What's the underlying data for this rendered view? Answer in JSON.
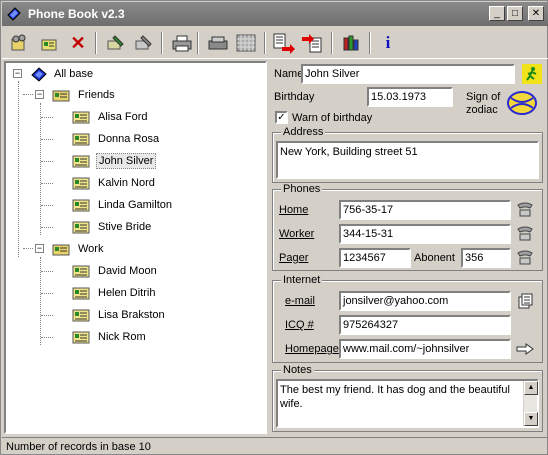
{
  "window": {
    "title": "Phone Book v2.3",
    "min": "_",
    "max": "□",
    "close": "✕"
  },
  "tree": {
    "root": "All base",
    "groups": [
      {
        "label": "Friends",
        "items": [
          "Alisa Ford",
          "Donna Rosa",
          "John Silver",
          "Kalvin Nord",
          "Linda Gamilton",
          "Stive Bride"
        ]
      },
      {
        "label": "Work",
        "items": [
          "David Moon",
          "Helen Ditrih",
          "Lisa Brakston",
          "Nick Rom"
        ]
      }
    ],
    "expander": "−"
  },
  "form": {
    "name_label": "Name",
    "name_value": "John Silver",
    "birthday_label": "Birthday",
    "birthday_value": "15.03.1973",
    "zodiac_label_1": "Sign of",
    "zodiac_label_2": "zodiac",
    "warn_label": "Warn of birthday",
    "warn_check": "✓",
    "address_title": "Address",
    "address_value": "New York, Building street 51",
    "phones_title": "Phones",
    "home_label": "Home",
    "home_value": "756-35-17",
    "worker_label": "Worker",
    "worker_value": "344-15-31",
    "pager_label": "Pager",
    "pager_value": "1234567",
    "abonent_label": "Abonent",
    "abonent_value": "356",
    "internet_title": "Internet",
    "email_label": "e-mail",
    "email_value": "jonsilver@yahoo.com",
    "icq_label": "ICQ #",
    "icq_value": "975264327",
    "homepage_label": "Homepage",
    "homepage_value": "www.mail.com/~johnsilver",
    "notes_title": "Notes",
    "notes_value": "The best my friend. It has dog and the beautiful wife.",
    "scroll_up": "▲",
    "scroll_down": "▼"
  },
  "toolbar": {
    "delete_glyph": "✕",
    "info_glyph": "i"
  },
  "status": {
    "text": "Number of records in base 10"
  },
  "colors": {
    "title_bg": "#7a7a7a",
    "face": "#d4d0c8",
    "delete_red": "#c00000",
    "info_blue": "#1010c0"
  }
}
